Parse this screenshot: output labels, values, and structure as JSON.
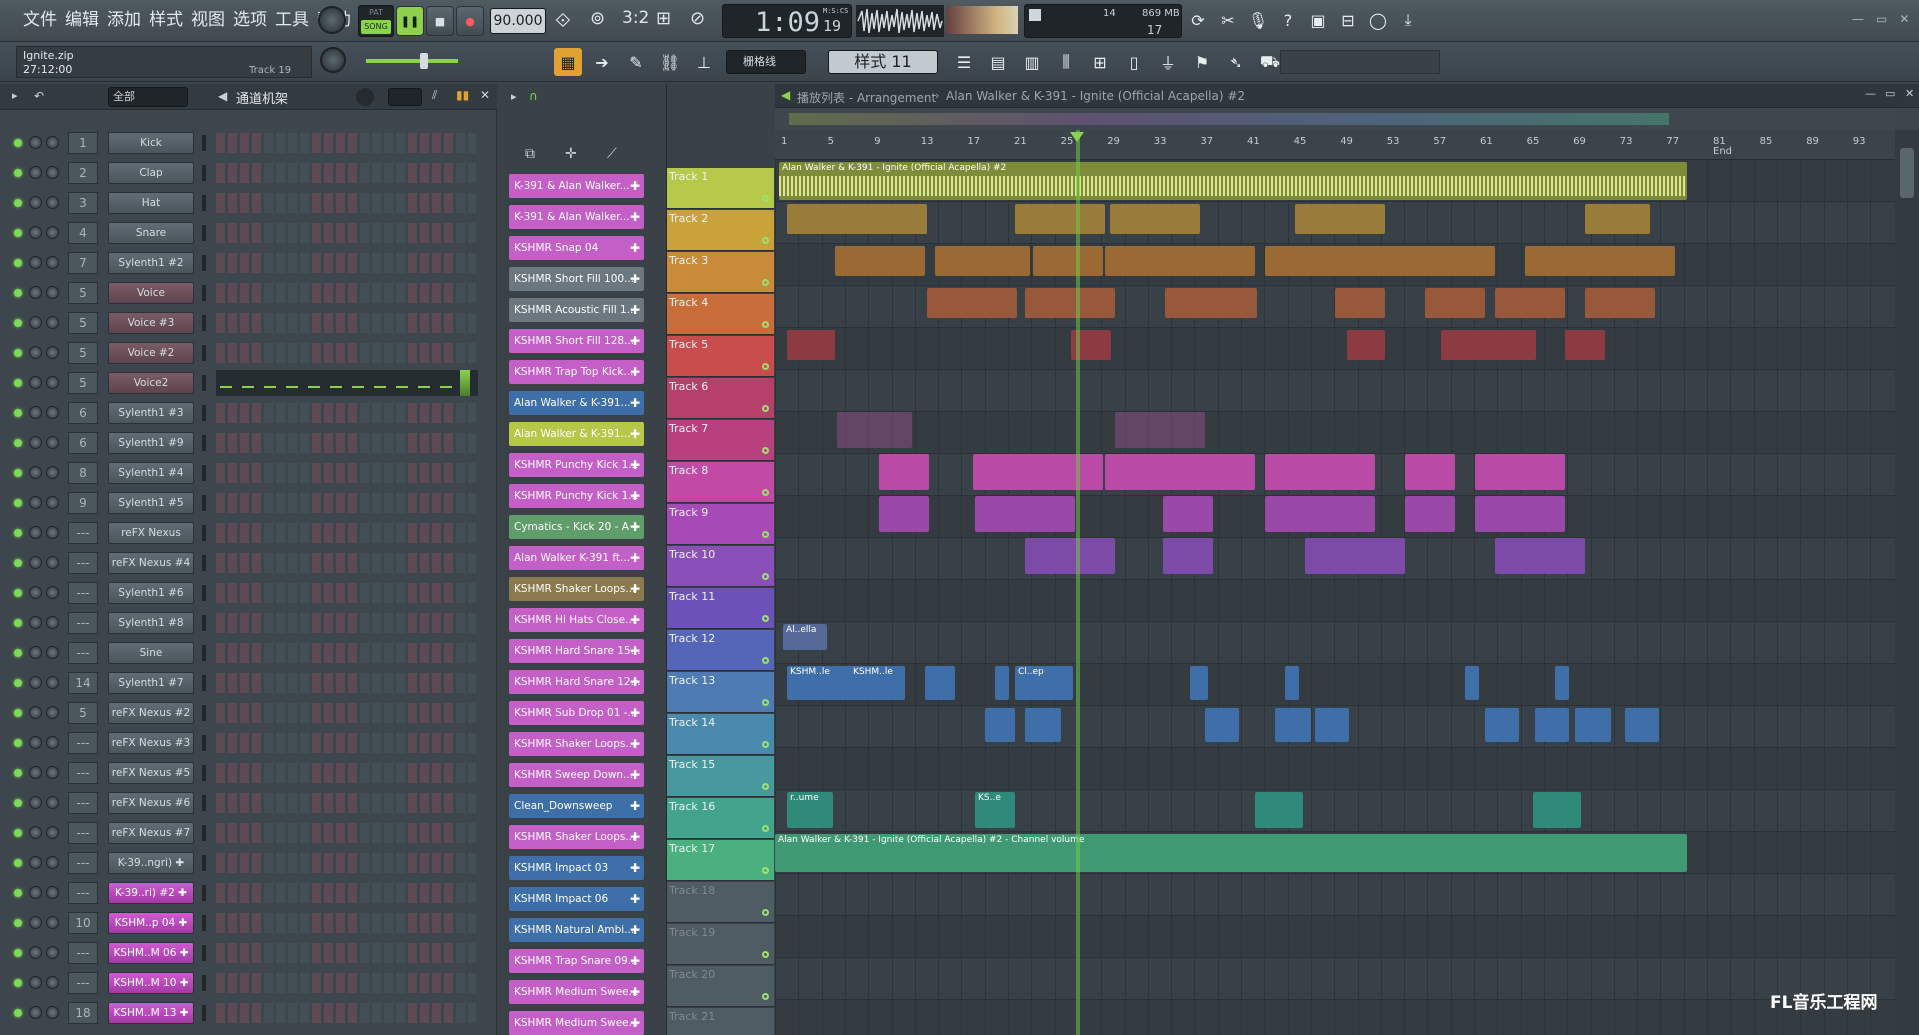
{
  "menu": [
    "文件",
    "编辑",
    "添加",
    "样式",
    "视图",
    "选项",
    "工具",
    "帮助"
  ],
  "transport": {
    "pat": "PAT",
    "song": "SONG",
    "tempo": "90.000",
    "time": "1:09",
    "time_frac": "19",
    "time_unit": "M:S:CS",
    "cpu": "14",
    "mem": "869 MB",
    "poly": "17"
  },
  "project": {
    "file": "Ignite.zip",
    "length": "27:12:00",
    "hint": "Track 19"
  },
  "toolbar2": {
    "snap": "栅格线",
    "pattern": "样式 11"
  },
  "rack": {
    "filter": "全部",
    "title": "通道机架"
  },
  "channels": [
    {
      "num": "1",
      "name": "Kick",
      "style": "normal"
    },
    {
      "num": "2",
      "name": "Clap",
      "style": "normal"
    },
    {
      "num": "3",
      "name": "Hat",
      "style": "normal"
    },
    {
      "num": "4",
      "name": "Snare",
      "style": "normal"
    },
    {
      "num": "7",
      "name": "Sylenth1 #2",
      "style": "normal"
    },
    {
      "num": "5",
      "name": "Voice",
      "style": "red"
    },
    {
      "num": "5",
      "name": "Voice #3",
      "style": "red"
    },
    {
      "num": "5",
      "name": "Voice #2",
      "style": "red"
    },
    {
      "num": "5",
      "name": "Voice2",
      "style": "red"
    },
    {
      "num": "6",
      "name": "Sylenth1 #3",
      "style": "normal"
    },
    {
      "num": "6",
      "name": "Sylenth1 #9",
      "style": "normal"
    },
    {
      "num": "8",
      "name": "Sylenth1 #4",
      "style": "normal"
    },
    {
      "num": "9",
      "name": "Sylenth1 #5",
      "style": "normal"
    },
    {
      "num": "---",
      "name": "reFX Nexus",
      "style": "normal"
    },
    {
      "num": "---",
      "name": "reFX Nexus #4",
      "style": "normal"
    },
    {
      "num": "---",
      "name": "Sylenth1 #6",
      "style": "normal"
    },
    {
      "num": "---",
      "name": "Sylenth1 #8",
      "style": "normal"
    },
    {
      "num": "---",
      "name": "Sine",
      "style": "normal"
    },
    {
      "num": "14",
      "name": "Sylenth1 #7",
      "style": "normal"
    },
    {
      "num": "5",
      "name": "reFX Nexus #2",
      "style": "normal"
    },
    {
      "num": "---",
      "name": "reFX Nexus #3",
      "style": "normal"
    },
    {
      "num": "---",
      "name": "reFX Nexus #5",
      "style": "normal"
    },
    {
      "num": "---",
      "name": "reFX Nexus #6",
      "style": "normal"
    },
    {
      "num": "---",
      "name": "reFX Nexus #7",
      "style": "normal"
    },
    {
      "num": "---",
      "name": "K-39..ngri) ✚",
      "style": "normal"
    },
    {
      "num": "---",
      "name": "K-39..ri) #2 ✚",
      "style": "pink"
    },
    {
      "num": "10",
      "name": "KSHM..p 04 ✚",
      "style": "pink"
    },
    {
      "num": "---",
      "name": "KSHM..M 06 ✚",
      "style": "pink"
    },
    {
      "num": "---",
      "name": "KSHM..M 10 ✚",
      "style": "pink"
    },
    {
      "num": "18",
      "name": "KSHM..M 13 ✚",
      "style": "pink"
    }
  ],
  "clips": [
    {
      "label": "K-391 & Alan Walker...",
      "color": "#c45fc7"
    },
    {
      "label": "K-391 & Alan Walker...",
      "color": "#c45fc7"
    },
    {
      "label": "KSHMR Snap 04",
      "color": "#c45fc7"
    },
    {
      "label": "KSHMR Short Fill 100...",
      "color": "#6d7780"
    },
    {
      "label": "KSHMR Acoustic Fill 1...",
      "color": "#6d7780"
    },
    {
      "label": "KSHMR Short Fill 128...",
      "color": "#c45fc7"
    },
    {
      "label": "KSHMR Trap Top Kick...",
      "color": "#c45fc7"
    },
    {
      "label": "Alan Walker & K-391...",
      "color": "#3f6fa8"
    },
    {
      "label": "Alan Walker & K-391...",
      "color": "#b6c84a"
    },
    {
      "label": "KSHMR Punchy Kick 1...",
      "color": "#c45fc7"
    },
    {
      "label": "KSHMR Punchy Kick 1...",
      "color": "#c45fc7"
    },
    {
      "label": "Cymatics - Kick 20 - A",
      "color": "#5f9d6a"
    },
    {
      "label": "Alan Walker K-391 ft...",
      "color": "#c45fc7"
    },
    {
      "label": "KSHMR Shaker Loops...",
      "color": "#8b7a4d"
    },
    {
      "label": "KSHMR Hi Hats Close...",
      "color": "#c45fc7"
    },
    {
      "label": "KSHMR Hard Snare 15...",
      "color": "#c45fc7"
    },
    {
      "label": "KSHMR Hard Snare 12...",
      "color": "#c45fc7"
    },
    {
      "label": "KSHMR Sub Drop 01 -...",
      "color": "#c45fc7"
    },
    {
      "label": "KSHMR Shaker Loops...",
      "color": "#c45fc7"
    },
    {
      "label": "KSHMR Sweep Down...",
      "color": "#c45fc7"
    },
    {
      "label": "Clean_Downsweep",
      "color": "#3f6fa8"
    },
    {
      "label": "KSHMR Shaker Loops...",
      "color": "#c45fc7"
    },
    {
      "label": "KSHMR Impact 03",
      "color": "#3f6fa8"
    },
    {
      "label": "KSHMR Impact 06",
      "color": "#3f6fa8"
    },
    {
      "label": "KSHMR Natural Ambi...",
      "color": "#3f6fa8"
    },
    {
      "label": "KSHMR Trap Snare 09...",
      "color": "#c45fc7"
    },
    {
      "label": "KSHMR Medium Swee...",
      "color": "#c45fc7"
    },
    {
      "label": "KSHMR Medium Swee...",
      "color": "#c45fc7"
    }
  ],
  "playlist": {
    "title": "播放列表 - Arrangement",
    "breadcrumb": "Alan Walker & K-391 - Ignite (Official Acapella) #2",
    "end": "End"
  },
  "bars": [
    "1",
    "5",
    "9",
    "13",
    "17",
    "21",
    "25",
    "29",
    "33",
    "37",
    "41",
    "45",
    "49",
    "53",
    "57",
    "61",
    "65",
    "69",
    "73",
    "77",
    "81",
    "85",
    "89",
    "93"
  ],
  "tracks": [
    {
      "name": "Track 1",
      "color": "#b7c94a"
    },
    {
      "name": "Track 2",
      "color": "#c9a23a"
    },
    {
      "name": "Track 3",
      "color": "#c98a3a"
    },
    {
      "name": "Track 4",
      "color": "#c96d3a"
    },
    {
      "name": "Track 5",
      "color": "#c94d4d"
    },
    {
      "name": "Track 6",
      "color": "#b5406a"
    },
    {
      "name": "Track 7",
      "color": "#b9407e"
    },
    {
      "name": "Track 8",
      "color": "#c24aa5"
    },
    {
      "name": "Track 9",
      "color": "#a64ab8"
    },
    {
      "name": "Track 10",
      "color": "#8a4fb8"
    },
    {
      "name": "Track 11",
      "color": "#6c52b8"
    },
    {
      "name": "Track 12",
      "color": "#5565b8"
    },
    {
      "name": "Track 13",
      "color": "#4f7bb5"
    },
    {
      "name": "Track 14",
      "color": "#4a8aae"
    },
    {
      "name": "Track 15",
      "color": "#47999f"
    },
    {
      "name": "Track 16",
      "color": "#43a48e"
    },
    {
      "name": "Track 17",
      "color": "#49b07e"
    },
    {
      "name": "Track 18",
      "color": "#4f5c63"
    },
    {
      "name": "Track 19",
      "color": "#4f5c63"
    },
    {
      "name": "Track 20",
      "color": "#4f5c63"
    },
    {
      "name": "Track 21",
      "color": "#4f5c63"
    }
  ],
  "arrangement_labels": {
    "t1": "Alan Walker & K-391 - Ignite (Official Acapella) #2",
    "t17": "Alan Walker & K-391 - Ignite (Official Acapella) #2 - Channel volume",
    "t12": "Al..ella",
    "t13a": "KSHM..le",
    "t13b": "KSHM..le",
    "t13c": "Cl..ep",
    "t16a": "r..ume",
    "t16b": "KS..e"
  },
  "watermark": "FL音乐工程网"
}
